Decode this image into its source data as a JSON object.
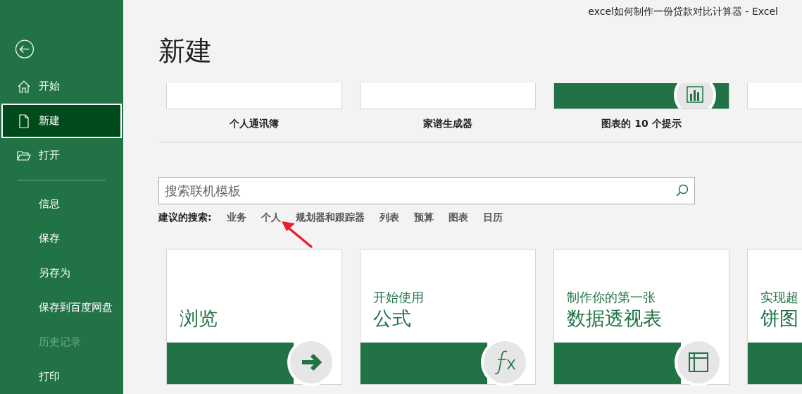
{
  "window": {
    "title": "excel如何制作一份贷款对比计算器  -  Excel"
  },
  "sidebar": {
    "primary": [
      {
        "label": "开始",
        "kind": "home",
        "selected": false,
        "disabled": false
      },
      {
        "label": "新建",
        "kind": "document",
        "selected": true,
        "disabled": false
      },
      {
        "label": "打开",
        "kind": "folder",
        "selected": false,
        "disabled": false
      }
    ],
    "secondary": [
      {
        "label": "信息",
        "selected": false,
        "disabled": false
      },
      {
        "label": "保存",
        "selected": false,
        "disabled": false
      },
      {
        "label": "另存为",
        "selected": false,
        "disabled": false
      },
      {
        "label": "保存到百度网盘",
        "selected": false,
        "disabled": false
      },
      {
        "label": "历史记录",
        "selected": false,
        "disabled": true
      },
      {
        "label": "打印",
        "selected": false,
        "disabled": false
      }
    ]
  },
  "heading": "新建",
  "top_templates": [
    {
      "label": "个人通讯簿",
      "kind": "blank"
    },
    {
      "label": "家谱生成器",
      "kind": "blank"
    },
    {
      "label": "图表的 10 个提示",
      "kind": "chart"
    },
    {
      "kind": "blank"
    }
  ],
  "search": {
    "placeholder": "搜索联机模板"
  },
  "suggested": {
    "label": "建议的搜索:",
    "items": [
      "业务",
      "个人",
      "规划器和跟踪器",
      "列表",
      "预算",
      "图表",
      "日历"
    ]
  },
  "featured": [
    {
      "line2": "浏览",
      "kind": "arrow"
    },
    {
      "line1": "开始使用",
      "line2": "公式",
      "kind": "fx"
    },
    {
      "line1": "制作你的第一张",
      "line2": "数据透视表",
      "kind": "pivot"
    },
    {
      "line1": "实现超",
      "line2": "饼图",
      "kind": "none"
    }
  ]
}
